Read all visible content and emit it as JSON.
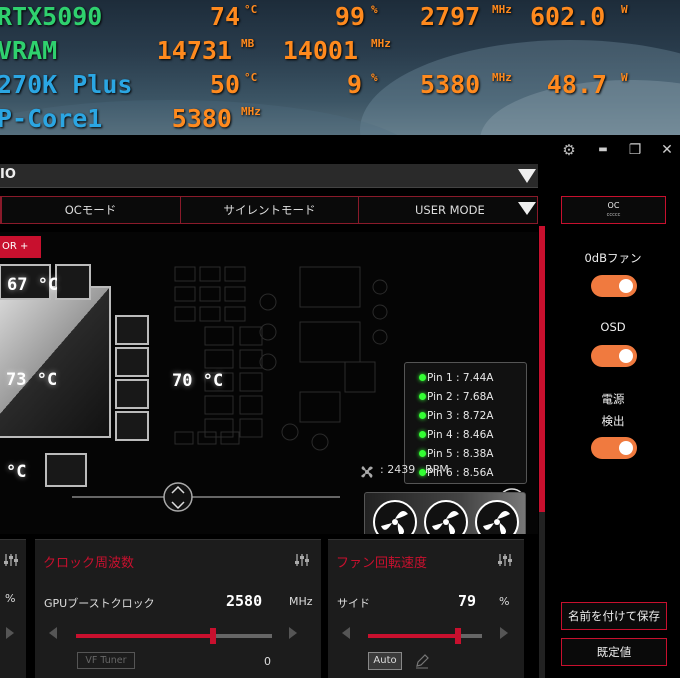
{
  "osd": {
    "rows": [
      {
        "label": "RTX5090",
        "cells": [
          {
            "v": "74",
            "u": "°C"
          },
          {
            "v": "99",
            "u": "%"
          },
          {
            "v": "2797",
            "u": "MHz"
          },
          {
            "v": "602.0",
            "u": "W"
          }
        ]
      },
      {
        "label": "VRAM",
        "cells": [
          {
            "v": "14731",
            "u": "MB"
          },
          {
            "v": "14001",
            "u": "MHz"
          }
        ]
      },
      {
        "label": "270K Plus",
        "cells": [
          {
            "v": "50",
            "u": "°C"
          },
          {
            "v": "9",
            "u": "%"
          },
          {
            "v": "5380",
            "u": "MHz"
          },
          {
            "v": "48.7",
            "u": "W"
          }
        ]
      },
      {
        "label": "P-Core1",
        "cells": [
          {
            "v": "5380",
            "u": "MHz"
          }
        ]
      }
    ],
    "colors": {
      "gpu_label": "#2fd16e",
      "cpu_label": "#2ba6e3",
      "value": "#ff8a1e"
    }
  },
  "window": {
    "title_fragment": "IO",
    "controls": [
      "gear-icon",
      "minimize-icon",
      "restore-icon",
      "close-icon"
    ],
    "control_glyphs": {
      "gear": "⚙",
      "minimize": "▬",
      "restore": "❐",
      "close": "✕"
    }
  },
  "tabs": [
    "",
    "OCモード",
    "サイレントモード",
    "USER MODE"
  ],
  "monitor": {
    "button_label": "OR +",
    "temps": {
      "top": "67 °C",
      "center": "73 °C",
      "right": "70 °C",
      "bottom": "°C"
    },
    "pins": [
      {
        "label": "Pin 1 : 7.44A"
      },
      {
        "label": "Pin 2 : 7.68A"
      },
      {
        "label": "Pin 3 : 8.72A"
      },
      {
        "label": "Pin 4 : 8.46A"
      },
      {
        "label": "Pin 5 : 8.38A"
      },
      {
        "label": "Pin 6 : 8.56A"
      }
    ],
    "fan_rpm": ": 2439",
    "rpm_unit": "RPM"
  },
  "right_panel": {
    "oc_label": "OC",
    "oc_sub": "ccccc",
    "toggles": [
      {
        "label": "0dBファン",
        "on": true
      },
      {
        "label": "OSD",
        "on": true
      },
      {
        "label": "電源\n検出",
        "on": true
      }
    ],
    "label_power_1": "電源",
    "label_power_2": "検出",
    "save_as": "名前を付けて保存",
    "default": "既定値"
  },
  "panels": {
    "left": {
      "unit": "%"
    },
    "clock": {
      "title": "クロック周波数",
      "label": "GPUブーストクロック",
      "value": "2580",
      "unit": "MHz",
      "vf_tuner": "VF Tuner",
      "offset": "0",
      "slider_fraction": 0.7
    },
    "fan": {
      "title": "ファン回転速度",
      "label": "サイド",
      "value": "79",
      "unit": "%",
      "auto": "Auto",
      "slider_fraction": 0.79
    }
  },
  "colors": {
    "accent": "#c8102e",
    "toggle": "#f07a3f"
  }
}
